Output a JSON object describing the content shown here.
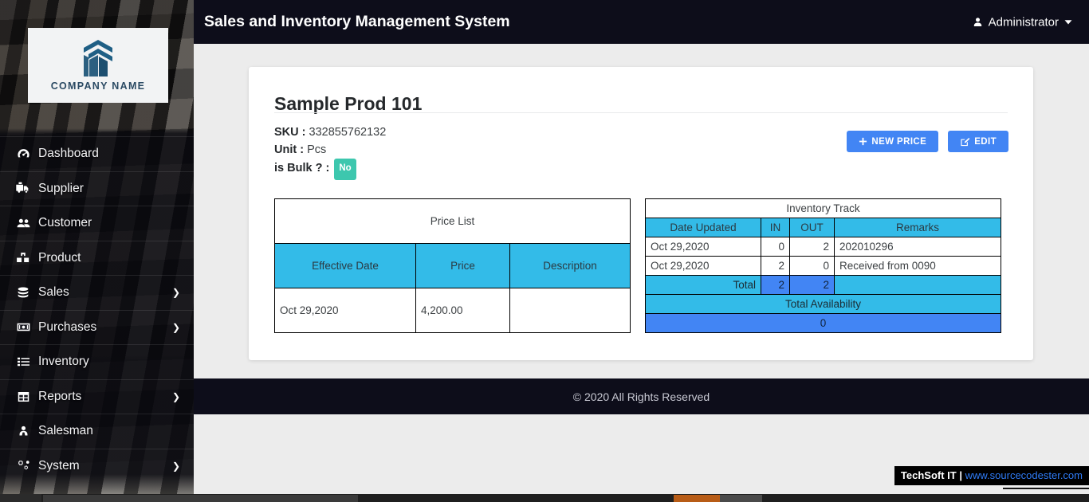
{
  "brand": {
    "logo_text": "COMPANY NAME",
    "logo_icon": "building-chevrons-icon"
  },
  "topbar": {
    "title": "Sales and Inventory Management System",
    "user_label": "Administrator",
    "user_icon": "user-icon",
    "caret_icon": "chevron-down-icon"
  },
  "sidebar": {
    "items": [
      {
        "label": "Dashboard",
        "icon": "tachometer-icon",
        "has_submenu": false
      },
      {
        "label": "Supplier",
        "icon": "truck-loading-icon",
        "has_submenu": false
      },
      {
        "label": "Customer",
        "icon": "users-icon",
        "has_submenu": false
      },
      {
        "label": "Product",
        "icon": "boxes-icon",
        "has_submenu": false
      },
      {
        "label": "Sales",
        "icon": "coins-icon",
        "has_submenu": true
      },
      {
        "label": "Purchases",
        "icon": "money-bill-icon",
        "has_submenu": true
      },
      {
        "label": "Inventory",
        "icon": "list-icon",
        "has_submenu": false
      },
      {
        "label": "Reports",
        "icon": "table-grid-icon",
        "has_submenu": true
      },
      {
        "label": "Salesman",
        "icon": "user-tie-icon",
        "has_submenu": false
      },
      {
        "label": "System",
        "icon": "cogs-icon",
        "has_submenu": true
      }
    ],
    "caret_glyph": "❯"
  },
  "product": {
    "name": "Sample Prod 101",
    "sku_label": "SKU :",
    "sku_value": "332855762132",
    "unit_label": "Unit :",
    "unit_value": "Pcs",
    "bulk_label": "is Bulk ? :",
    "bulk_value": "No",
    "bulk_badge_color": "#3dc7ae"
  },
  "actions": {
    "new_price_label": "NEW PRICE",
    "new_price_icon": "plus-icon",
    "edit_label": "EDIT",
    "edit_icon": "pencil-square-icon",
    "button_color": "#4285f4"
  },
  "price_list": {
    "caption": "Price List",
    "columns": [
      "Effective Date",
      "Price",
      "Description"
    ],
    "rows": [
      [
        "Oct 29,2020",
        "4,200.00",
        ""
      ]
    ]
  },
  "inventory_track": {
    "caption": "Inventory Track",
    "columns": [
      "Date Updated",
      "IN",
      "OUT",
      "Remarks"
    ],
    "rows": [
      [
        "Oct 29,2020",
        "0",
        "2",
        "202010296"
      ],
      [
        "Oct 29,2020",
        "2",
        "0",
        "Received from 0090"
      ]
    ],
    "total_label": "Total",
    "total_in": "2",
    "total_out": "2",
    "availability_label": "Total Availability",
    "availability_value": "0",
    "header_color": "#33bbe8",
    "total_color": "#4285f4"
  },
  "footer": {
    "text": "© 2020 All Rights Reserved"
  },
  "watermark": {
    "brand": "TechSoft IT",
    "separator": "|",
    "url": "www.sourcecodester.com"
  }
}
